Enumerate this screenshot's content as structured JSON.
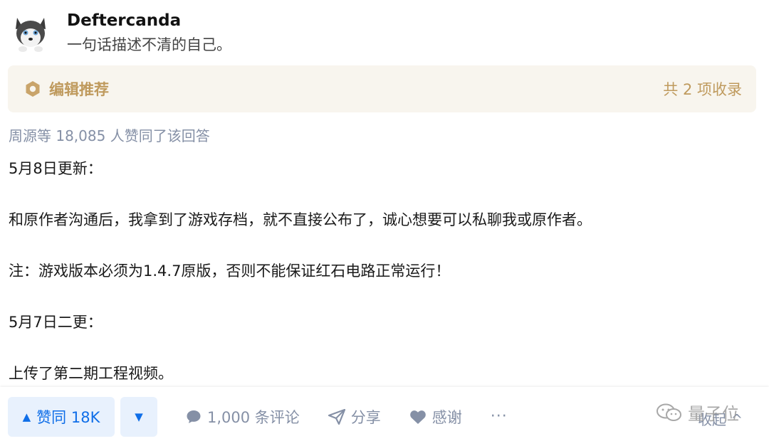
{
  "author": {
    "name": "Deftercanda",
    "bio": "一句话描述不清的自己。"
  },
  "recommend": {
    "label": "编辑推荐",
    "count": "共 2 项收录"
  },
  "voters": "周源等 18,085 人赞同了该回答",
  "content": {
    "paragraphs": [
      "5月8日更新：",
      "和原作者沟通后，我拿到了游戏存档，就不直接公布了，诚心想要可以私聊我或原作者。",
      "注：游戏版本必须为1.4.7原版，否则不能保证红石电路正常运行！",
      "5月7日二更：",
      "上传了第二期工程视频。"
    ]
  },
  "actions": {
    "upvote_label": "赞同 18K",
    "comment_label": "1,000 条评论",
    "share_label": "分享",
    "thanks_label": "感谢",
    "more_label": "···",
    "collapse_label": "收起 ^"
  },
  "watermark": {
    "text": "量子位"
  },
  "colors": {
    "primary_blue": "#0f6ee8",
    "gold": "#bf9a5d",
    "muted": "#8590a6"
  }
}
